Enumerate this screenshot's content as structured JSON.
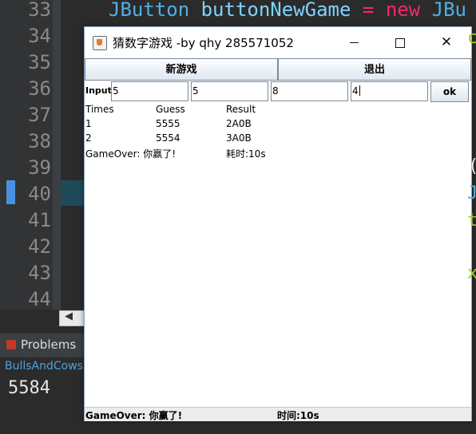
{
  "ide": {
    "line_numbers": [
      "33",
      "34",
      "35",
      "36",
      "37",
      "38",
      "39",
      "40",
      "41",
      "42",
      "43",
      "44"
    ],
    "code_line_33": {
      "type": "JButton",
      "ident": "buttonNewGame",
      "op": "=",
      "kw": "new",
      "rest": "JBu"
    },
    "panel_tab": "Problems",
    "console_title": "BullsAndCows",
    "console_output": "5584"
  },
  "window": {
    "title": "猜数字游戏 -by qhy 285571052",
    "buttons": {
      "new_game": "新游戏",
      "exit": "退出"
    },
    "input": {
      "label": "Input:",
      "digits": [
        "5",
        "5",
        "8",
        "4"
      ],
      "ok": "ok"
    },
    "table": {
      "headers": [
        "Times",
        "Guess",
        "Result"
      ],
      "rows": [
        [
          "1",
          "5555",
          "2A0B"
        ],
        [
          "2",
          "5554",
          "3A0B"
        ]
      ],
      "game_over": {
        "text": "GameOver: 你赢了!",
        "time": "耗时:10s"
      }
    },
    "status": {
      "left": "GameOver: 你赢了!",
      "right": "时间:10s"
    }
  }
}
